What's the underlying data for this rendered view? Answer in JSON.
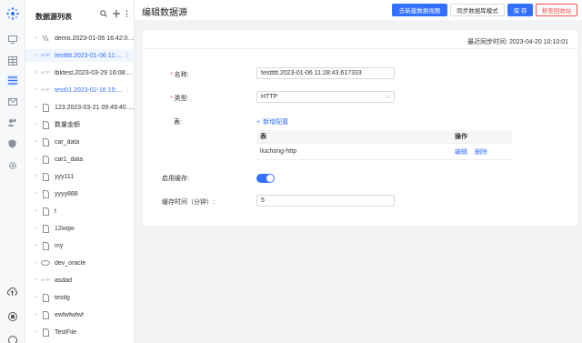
{
  "sidebar": {
    "title": "数据源列表",
    "items": [
      {
        "label": "demo.2023-01-06 16:42:04.…",
        "icon": "folder-link-icon",
        "selected": false
      },
      {
        "label": "testtttt.2023-01-06 11:28:4…",
        "icon": "http-icon",
        "selected": true
      },
      {
        "label": "lbktest.2023-03-29 16:08:1…",
        "icon": "http-icon",
        "selected": false
      },
      {
        "label": "test01.2023-02-16 15:…",
        "icon": "http-icon",
        "selected": false,
        "highlight": true
      },
      {
        "label": "123.2023-03-21 09:49:40.8…",
        "icon": "file-icon",
        "selected": false
      },
      {
        "label": "数量金额",
        "icon": "file-icon",
        "selected": false
      },
      {
        "label": "car_data",
        "icon": "file-icon",
        "selected": false
      },
      {
        "label": "car1_data",
        "icon": "file-icon",
        "selected": false
      },
      {
        "label": "yyy111",
        "icon": "file-icon",
        "selected": false
      },
      {
        "label": "yyyy888",
        "icon": "file-icon",
        "selected": false
      },
      {
        "label": "t",
        "icon": "file-icon",
        "selected": false
      },
      {
        "label": "12wqw",
        "icon": "file-icon",
        "selected": false
      },
      {
        "label": "my",
        "icon": "file-icon",
        "selected": false
      },
      {
        "label": "dev_oracle",
        "icon": "db-icon",
        "selected": false
      },
      {
        "label": "asdad",
        "icon": "http-icon",
        "selected": false
      },
      {
        "label": "testlg",
        "icon": "file-icon",
        "selected": false
      },
      {
        "label": "ewfwfwfwf",
        "icon": "file-icon",
        "selected": false
      },
      {
        "label": "TestFile",
        "icon": "file-icon",
        "selected": false
      }
    ]
  },
  "header": {
    "title": "编辑数据源",
    "btn_new_view": "去新建数据视图",
    "btn_sync_mode": "同步数据库模式",
    "btn_save": "保 存",
    "btn_recycle": "移至回收站"
  },
  "form": {
    "sync_time": "最近同步时间: 2023-04-20 10:10:01",
    "name_label": "名称:",
    "name_value": "testtttt.2023-01-06 11:28:43.617333",
    "type_label": "类型:",
    "type_value": "HTTP",
    "table_label": "表:",
    "add_config": "新增配置",
    "table": {
      "col_table": "表",
      "col_action": "操作",
      "rows": [
        {
          "name": "liuchong-http",
          "edit": "编辑",
          "delete": "删除"
        }
      ]
    },
    "cache_label": "启用缓存:",
    "cache_enabled": true,
    "cache_time_label": "缓存时间（分钟）:",
    "cache_time_value": "5"
  },
  "colors": {
    "primary": "#3370ff",
    "danger": "#f54a45"
  }
}
